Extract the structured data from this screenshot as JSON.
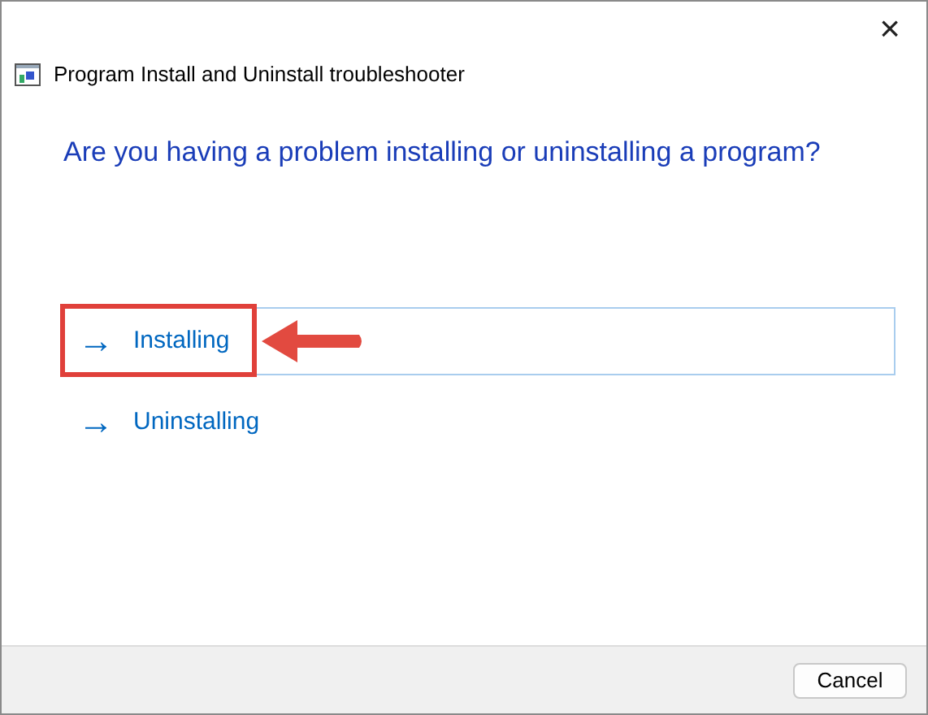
{
  "window": {
    "title": "Program Install and Uninstall troubleshooter",
    "close": "×"
  },
  "question": "Are you having a problem installing or uninstalling a program?",
  "options": [
    {
      "arrow": "→",
      "label": "Installing",
      "selected": true,
      "annotated": true
    },
    {
      "arrow": "→",
      "label": "Uninstalling",
      "selected": false,
      "annotated": false
    }
  ],
  "buttons": [
    "Cancel"
  ]
}
